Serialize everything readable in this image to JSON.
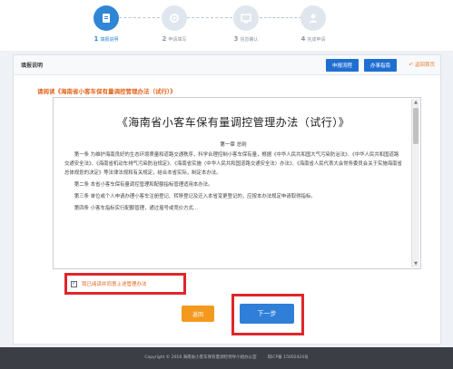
{
  "steps": [
    {
      "num": "1",
      "label": "填报说明",
      "icon": "document-icon"
    },
    {
      "num": "2",
      "label": "申请填写",
      "icon": "gear-icon"
    },
    {
      "num": "3",
      "label": "信息确认",
      "icon": "monitor-icon"
    },
    {
      "num": "4",
      "label": "完成申请",
      "icon": "user-icon"
    }
  ],
  "panel": {
    "title": "填报说明",
    "btn_flow": "申报流程",
    "btn_guide": "办事指南",
    "back_home": "返回首页"
  },
  "notice": "请阅读《海南省小客车保有量调控管理办法（试行）》",
  "document": {
    "title": "《海南省小客车保有量调控管理办法（试行）》",
    "chapter": "第一章  总则",
    "paragraphs": [
      "第一条  为维护海南良好的生态环境质量和道路交通秩序，科学合理控制小客车保有量，根据《中华人民共和国大气污染防治法》、《中华人民共和国道路交通安全法》、《海南省机动车排气污染防治规定》、《海南省实施〈中华人民共和国道路交通安全法〉办法》、《海南省人民代表大会常务委员会关于实施海南省总体规划的决定》等法律法规和有关规定，结合本省实际，制定本办法。",
      "第二条  本省小客车保有量调控管理和配额指标管理适用本办法。",
      "第三条  单位或个人申请办理小客车注册登记、转移登记及迁入本省变更登记的，应按本办法规定申请取得指标。",
      "第四条  小客车指标实行配额管理，通过摇号或竞价方式..."
    ]
  },
  "agree_label": "我已阅读并同意上述管理办法",
  "agree_checked": true,
  "buttons": {
    "back": "返回",
    "next": "下一步"
  },
  "footer": {
    "copyright": "Copyright © 2018   海南省小客车保有量调控领导小组办公室",
    "icp": "琼ICP备 15002424号"
  }
}
